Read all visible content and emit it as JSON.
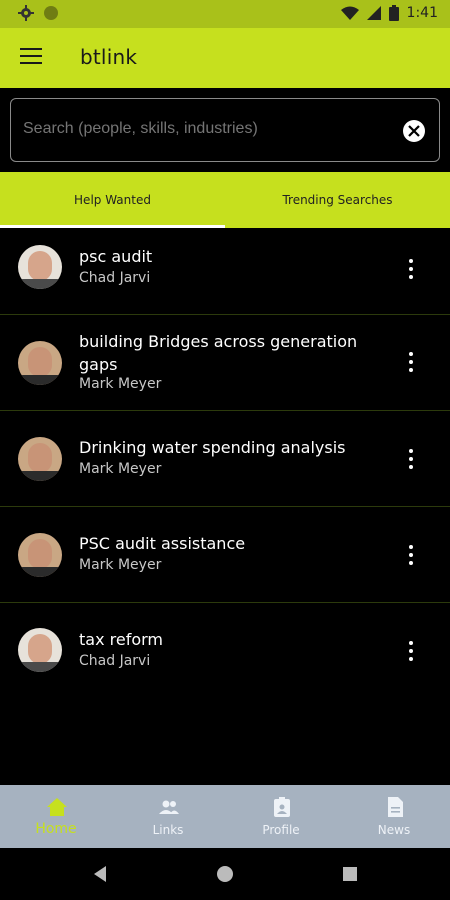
{
  "status_bar": {
    "time": "1:41"
  },
  "app_bar": {
    "title": "btlink",
    "menu_icon": "menu-icon"
  },
  "search": {
    "placeholder": "Search (people, skills, industries)",
    "value": "",
    "clear_icon": "close-icon"
  },
  "tabs": [
    {
      "label": "Help Wanted",
      "active": true
    },
    {
      "label": "Trending Searches",
      "active": false
    }
  ],
  "items": [
    {
      "title": "psc audit",
      "author": "Chad Jarvi"
    },
    {
      "title": "building Bridges across generation gaps",
      "author": "Mark Meyer"
    },
    {
      "title": "Drinking water spending analysis",
      "author": "Mark Meyer"
    },
    {
      "title": "PSC audit assistance",
      "author": "Mark Meyer"
    },
    {
      "title": "tax reform",
      "author": "Chad Jarvi"
    }
  ],
  "bottom_nav": [
    {
      "label": "Home",
      "icon": "home-icon",
      "active": true
    },
    {
      "label": "Links",
      "icon": "people-icon",
      "active": false
    },
    {
      "label": "Profile",
      "icon": "profile-badge-icon",
      "active": false
    },
    {
      "label": "News",
      "icon": "document-icon",
      "active": false
    }
  ],
  "colors": {
    "accent": "#c6e01e",
    "status_bar": "#a9c11a",
    "nav_bg": "#a6b2c0",
    "background": "#000000"
  }
}
